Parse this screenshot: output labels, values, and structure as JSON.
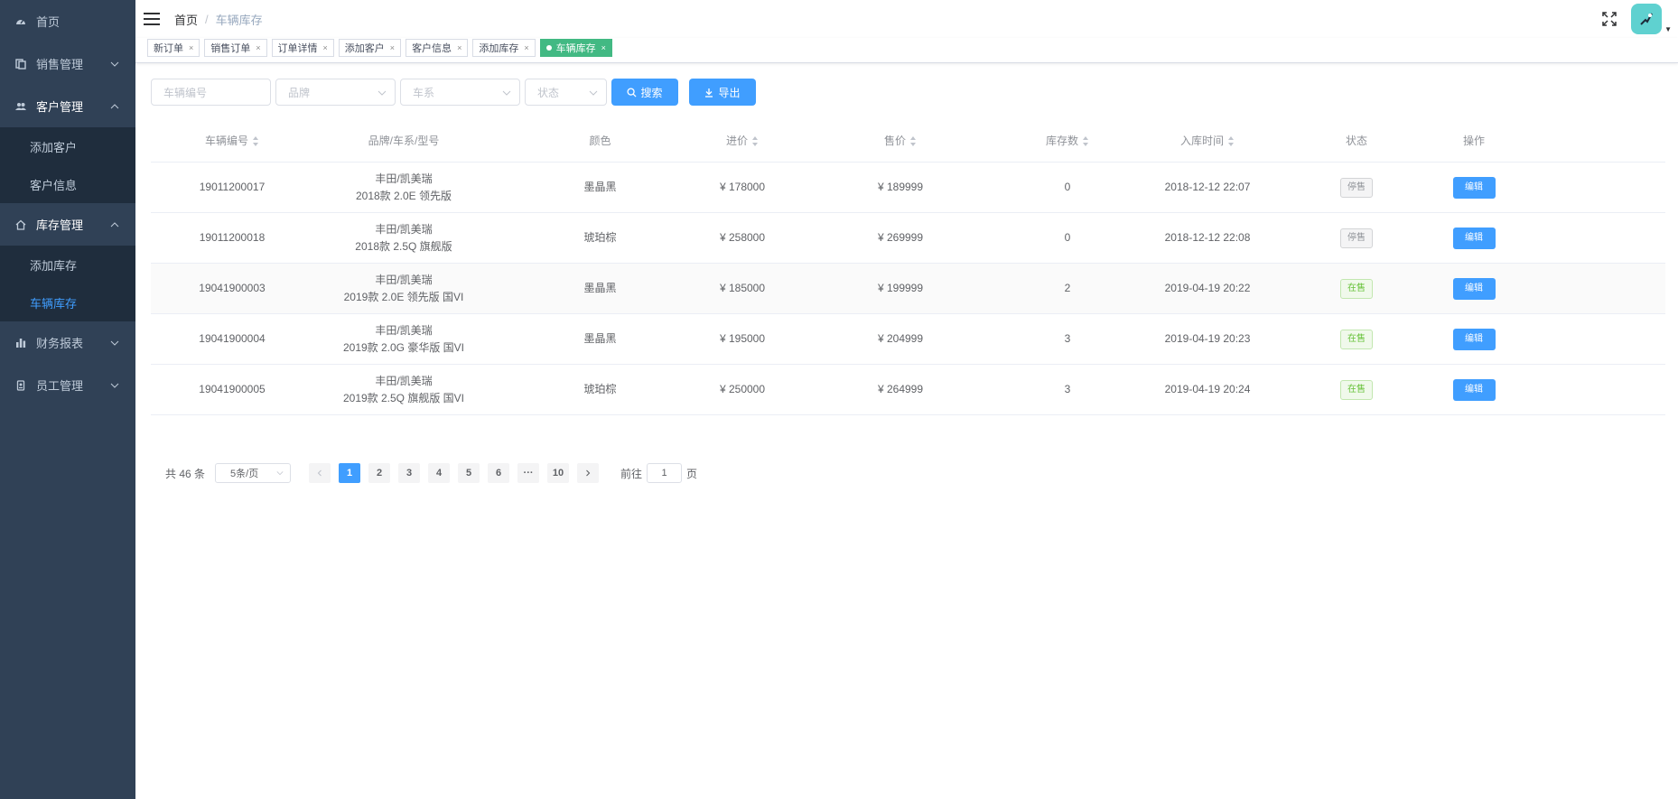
{
  "sidebar": {
    "home": "首页",
    "sales": "销售管理",
    "customer": "客户管理",
    "customer_items": [
      "添加客户",
      "客户信息"
    ],
    "stock": "库存管理",
    "stock_items": [
      "添加库存",
      "车辆库存"
    ],
    "finance": "财务报表",
    "staff": "员工管理"
  },
  "header": {
    "breadcrumb_home": "首页",
    "breadcrumb_sep": "/",
    "breadcrumb_current": "车辆库存"
  },
  "tags": [
    "新订单",
    "销售订单",
    "订单详情",
    "添加客户",
    "客户信息",
    "添加库存",
    "车辆库存"
  ],
  "filters": {
    "vehicle_no_placeholder": "车辆编号",
    "brand_placeholder": "品牌",
    "series_placeholder": "车系",
    "status_placeholder": "状态",
    "search_label": "搜索",
    "export_label": "导出"
  },
  "table": {
    "headers": [
      "车辆编号",
      "品牌/车系/型号",
      "颜色",
      "进价",
      "售价",
      "库存数",
      "入库时间",
      "状态",
      "操作"
    ],
    "rows": [
      {
        "id": "19011200017",
        "model1": "丰田/凯美瑞",
        "model2": "2018款 2.0E 领先版",
        "color": "墨晶黑",
        "buy": "¥ 178000",
        "sell": "¥ 189999",
        "stock": "0",
        "time": "2018-12-12 22:07",
        "status": "停售",
        "action": "编辑"
      },
      {
        "id": "19011200018",
        "model1": "丰田/凯美瑞",
        "model2": "2018款 2.5Q 旗舰版",
        "color": "琥珀棕",
        "buy": "¥ 258000",
        "sell": "¥ 269999",
        "stock": "0",
        "time": "2018-12-12 22:08",
        "status": "停售",
        "action": "编辑"
      },
      {
        "id": "19041900003",
        "model1": "丰田/凯美瑞",
        "model2": "2019款 2.0E 领先版 国VI",
        "color": "墨晶黑",
        "buy": "¥ 185000",
        "sell": "¥ 199999",
        "stock": "2",
        "time": "2019-04-19 20:22",
        "status": "在售",
        "action": "编辑"
      },
      {
        "id": "19041900004",
        "model1": "丰田/凯美瑞",
        "model2": "2019款 2.0G 豪华版 国VI",
        "color": "墨晶黑",
        "buy": "¥ 195000",
        "sell": "¥ 204999",
        "stock": "3",
        "time": "2019-04-19 20:23",
        "status": "在售",
        "action": "编辑"
      },
      {
        "id": "19041900005",
        "model1": "丰田/凯美瑞",
        "model2": "2019款 2.5Q 旗舰版 国VI",
        "color": "琥珀棕",
        "buy": "¥ 250000",
        "sell": "¥ 264999",
        "stock": "3",
        "time": "2019-04-19 20:24",
        "status": "在售",
        "action": "编辑"
      }
    ]
  },
  "pagination": {
    "total": "共 46 条",
    "page_size": "5条/页",
    "pages": [
      "1",
      "2",
      "3",
      "4",
      "5",
      "6",
      "···",
      "10"
    ],
    "goto_prefix": "前往",
    "goto_value": "1",
    "goto_suffix": "页"
  },
  "colors": {
    "sidebar_bg": "#304156",
    "submenu_bg": "#1f2d3d",
    "primary": "#409eff",
    "active_tag": "#42b983"
  }
}
